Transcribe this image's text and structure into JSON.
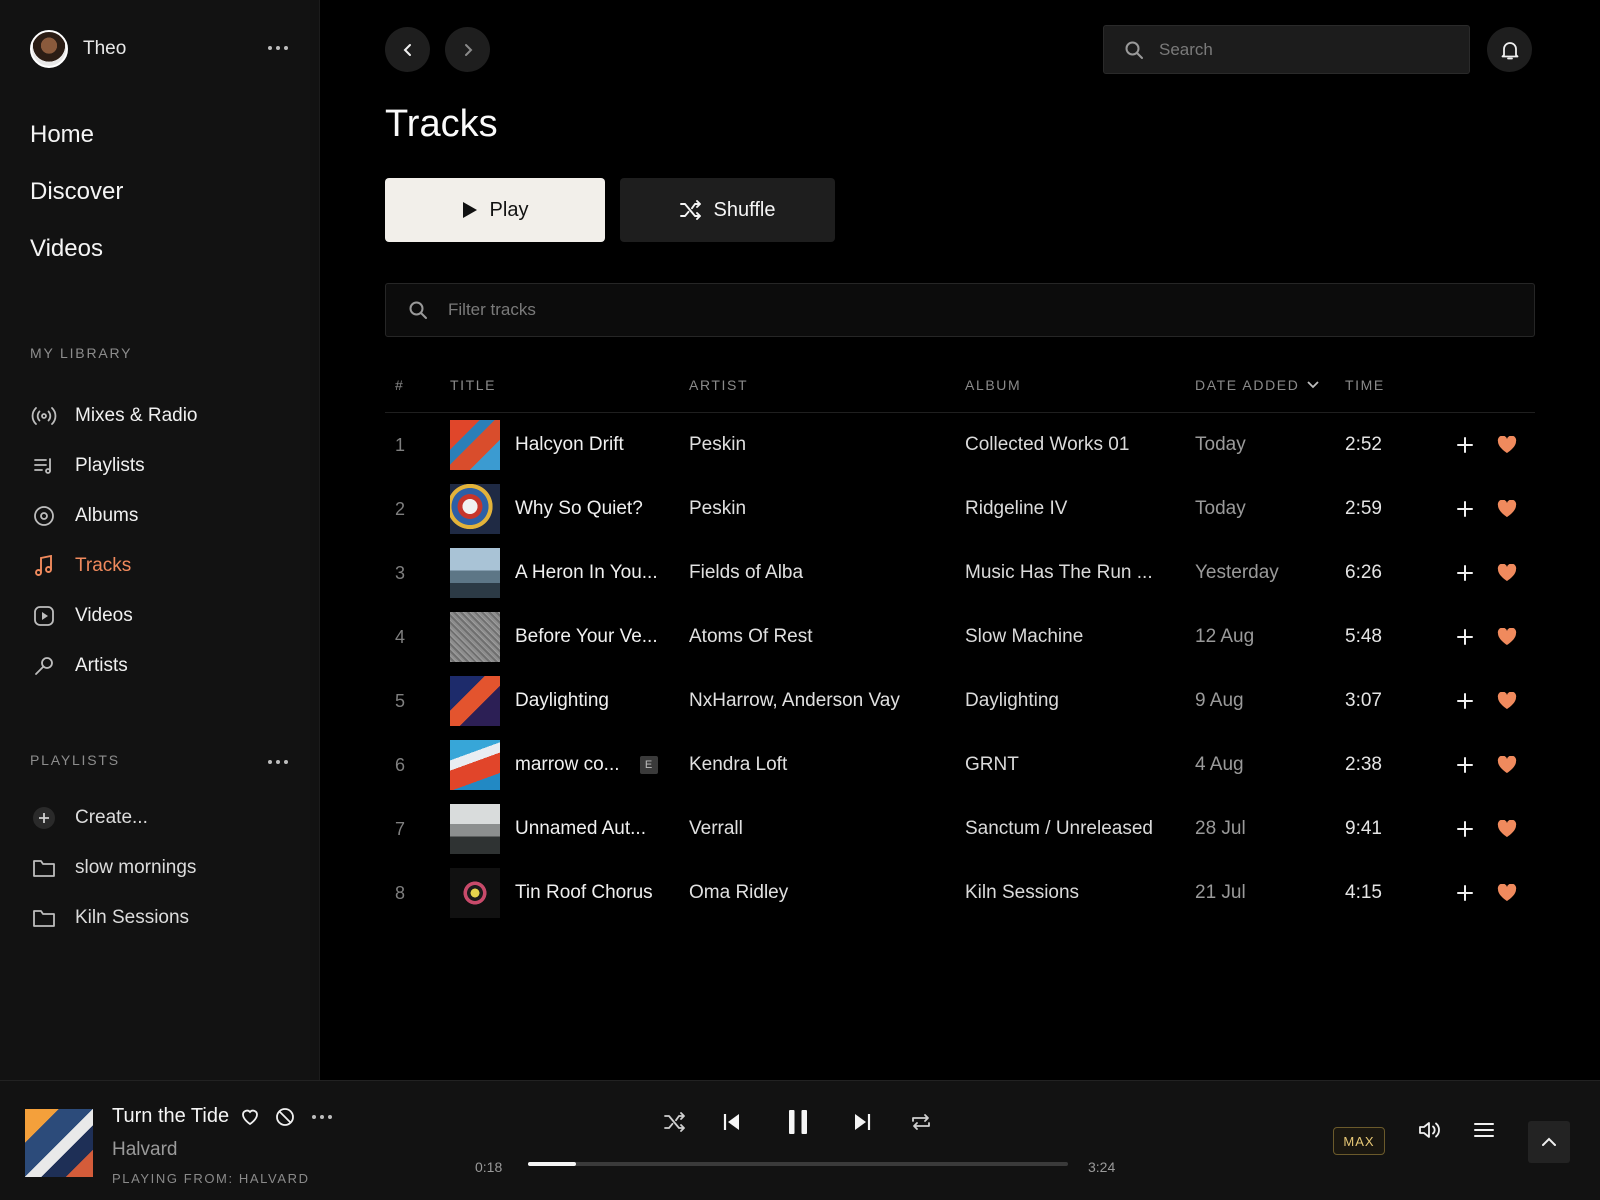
{
  "user": {
    "name": "Theo"
  },
  "nav": {
    "items": [
      "Home",
      "Discover",
      "Videos"
    ]
  },
  "library": {
    "label": "MY LIBRARY",
    "items": [
      {
        "label": "Mixes & Radio",
        "icon": "radio-icon"
      },
      {
        "label": "Playlists",
        "icon": "playlist-icon"
      },
      {
        "label": "Albums",
        "icon": "album-icon"
      },
      {
        "label": "Tracks",
        "icon": "music-note-icon",
        "active": true
      },
      {
        "label": "Videos",
        "icon": "video-icon"
      },
      {
        "label": "Artists",
        "icon": "microphone-icon"
      }
    ]
  },
  "playlists": {
    "label": "PLAYLISTS",
    "items": [
      {
        "label": "Create...",
        "icon": "plus-icon"
      },
      {
        "label": "slow mornings",
        "icon": "folder-icon"
      },
      {
        "label": "Kiln Sessions",
        "icon": "folder-icon"
      }
    ]
  },
  "search": {
    "placeholder": "Search"
  },
  "page": {
    "title": "Tracks",
    "play_label": "Play",
    "shuffle_label": "Shuffle",
    "filter_placeholder": "Filter tracks"
  },
  "table": {
    "columns": {
      "num": "#",
      "title": "TITLE",
      "artist": "ARTIST",
      "album": "ALBUM",
      "date": "DATE ADDED",
      "time": "TIME"
    },
    "rows": [
      {
        "num": "1",
        "title": "Halcyon Drift",
        "artist": "Peskin",
        "album": "Collected Works 01",
        "date": "Today",
        "time": "2:52",
        "art": "linear-gradient(135deg,#e0462a 0 30%,#2a7fb8 30% 45%,#d94d2c 45% 70%,#3b9bd1 70%)"
      },
      {
        "num": "2",
        "title": "Why So Quiet?",
        "artist": "Peskin",
        "album": "Ridgeline IV",
        "date": "Today",
        "time": "2:59",
        "art": "radial-gradient(circle at 40% 45%,#f1f1f1 0 18%,#c7352b 19% 30%,#2d5fa6 31% 45%,#e3b33a 46% 55%,#1f2a44 56%)"
      },
      {
        "num": "3",
        "title": "A Heron In You...",
        "artist": "Fields of Alba",
        "album": "Music Has The Run ...",
        "date": "Yesterday",
        "time": "6:26",
        "art": "linear-gradient(180deg,#a9c3d6 0 45%,#5d7686 45% 70%,#2c3a45 70%)"
      },
      {
        "num": "4",
        "title": "Before Your Ve...",
        "artist": "Atoms Of Rest",
        "album": "Slow Machine",
        "date": "12 Aug",
        "time": "5:48",
        "art": "repeating-linear-gradient(45deg,#8d8d8d 0 2px,#6f6f6f 2px 4px,#9c9c9c 4px 5px)"
      },
      {
        "num": "5",
        "title": "Daylighting",
        "artist": "NxHarrow, Anderson Vay",
        "album": "Daylighting",
        "date": "9 Aug",
        "time": "3:07",
        "art": "linear-gradient(135deg,#1d2b6b 0 35%,#e3542e 35% 60%,#2c1f55 60%)"
      },
      {
        "num": "6",
        "title": "marrow co...",
        "explicit": "E",
        "artist": "Kendra Loft",
        "album": "GRNT",
        "date": "4 Aug",
        "time": "2:38",
        "art": "linear-gradient(160deg,#37a6d8 0 30%,#e9edf2 30% 45%,#e1452a 45% 75%,#2289c4 75%)"
      },
      {
        "num": "7",
        "title": "Unnamed Aut...",
        "artist": "Verrall",
        "album": "Sanctum / Unreleased",
        "date": "28 Jul",
        "time": "9:41",
        "art": "linear-gradient(180deg,#d9dcdc 0 40%,#8c8f8f 40% 65%,#2f3333 65%)"
      },
      {
        "num": "8",
        "title": "Tin Roof Chorus",
        "artist": "Oma Ridley",
        "album": "Kiln Sessions",
        "date": "21 Jul",
        "time": "4:15",
        "art": "radial-gradient(circle,#e6d34c 0 12%,#1b1b1b 13% 22%,#c84a6a 23% 32%,#111 33%)"
      }
    ]
  },
  "player": {
    "title": "Turn the Tide",
    "artist": "Halvard",
    "playing_from": "PLAYING FROM: HALVARD",
    "current_time": "0:18",
    "total_time": "3:24",
    "progress": 0.088,
    "quality": "MAX"
  },
  "colors": {
    "accent": "#f08a5d",
    "background": "#000000",
    "sidebar": "#121212"
  }
}
